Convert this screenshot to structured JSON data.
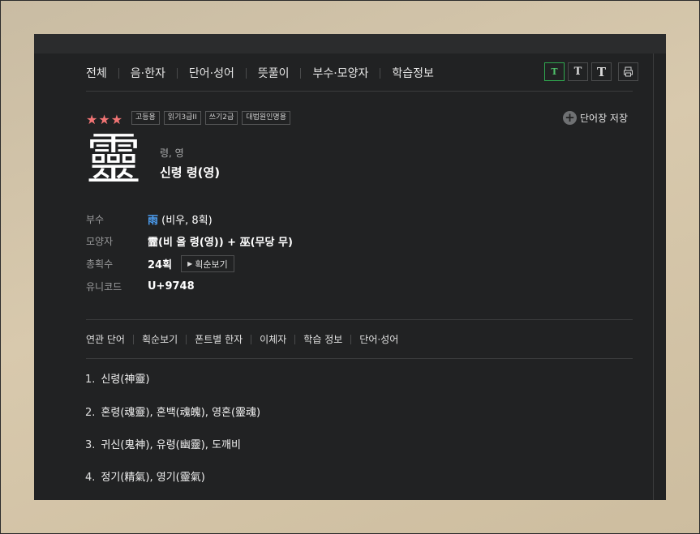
{
  "nav": {
    "tabs": [
      "전체",
      "음·한자",
      "단어·성어",
      "뜻풀이",
      "부수·모양자",
      "학습정보"
    ],
    "font_buttons": [
      "T",
      "T",
      "T"
    ],
    "print_icon": "printer-icon"
  },
  "entry": {
    "stars": "★★★",
    "badges": [
      "고등용",
      "읽기3급II",
      "쓰기2급",
      "대법원인명용"
    ],
    "save_label": "단어장 저장",
    "hanja": "靈",
    "reading": "령, 영",
    "meaning": "신령 령(영)"
  },
  "info": {
    "radical_label": "부수",
    "radical_char": "雨",
    "radical_rest": " (비우, 8획)",
    "shape_label": "모양자",
    "shape_value": "霝(비 올 령(영)) + 巫(무당 무)",
    "strokes_label": "총획수",
    "strokes_value": "24획",
    "stroke_button": "획순보기",
    "unicode_label": "유니코드",
    "unicode_value": "U+9748"
  },
  "subtabs": [
    "연관 단어",
    "획순보기",
    "폰트별 한자",
    "이체자",
    "학습 정보",
    "단어·성어"
  ],
  "related_words": [
    {
      "num": "1.",
      "text": "신령(神靈)"
    },
    {
      "num": "2.",
      "text": "혼령(魂靈), 혼백(魂魄), 영혼(靈魂)"
    },
    {
      "num": "3.",
      "text": "귀신(鬼神), 유령(幽靈), 도깨비"
    },
    {
      "num": "4.",
      "text": "정기(精氣), 영기(靈氣)"
    }
  ],
  "colors": {
    "panel": "#212223",
    "star": "#f17474",
    "radical": "#4c9ef2",
    "active_font": "#2fa84f"
  }
}
